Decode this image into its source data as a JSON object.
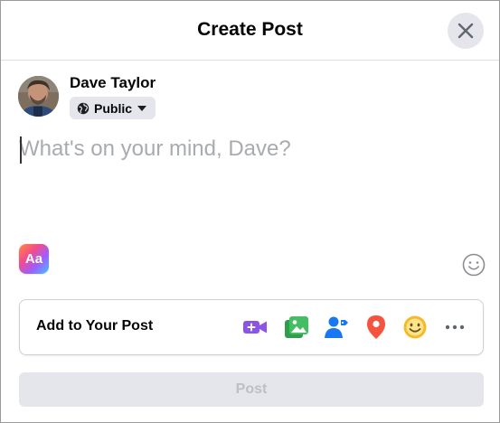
{
  "header": {
    "title": "Create Post"
  },
  "user": {
    "name": "Dave Taylor",
    "privacy": "Public"
  },
  "composer": {
    "placeholder": "What's on your mind, Dave?"
  },
  "text_format": {
    "label": "Aa"
  },
  "add_to_post": {
    "label": "Add to Your Post",
    "icons": [
      "live-video-icon",
      "photo-video-icon",
      "tag-people-icon",
      "check-in-icon",
      "feeling-icon",
      "more-icon"
    ]
  },
  "post_button": {
    "label": "Post"
  },
  "colors": {
    "live_video": "#8c54e6",
    "photo": "#45bd62",
    "tag": "#1877f2",
    "checkin": "#f5533d",
    "feeling": "#f7b928"
  }
}
